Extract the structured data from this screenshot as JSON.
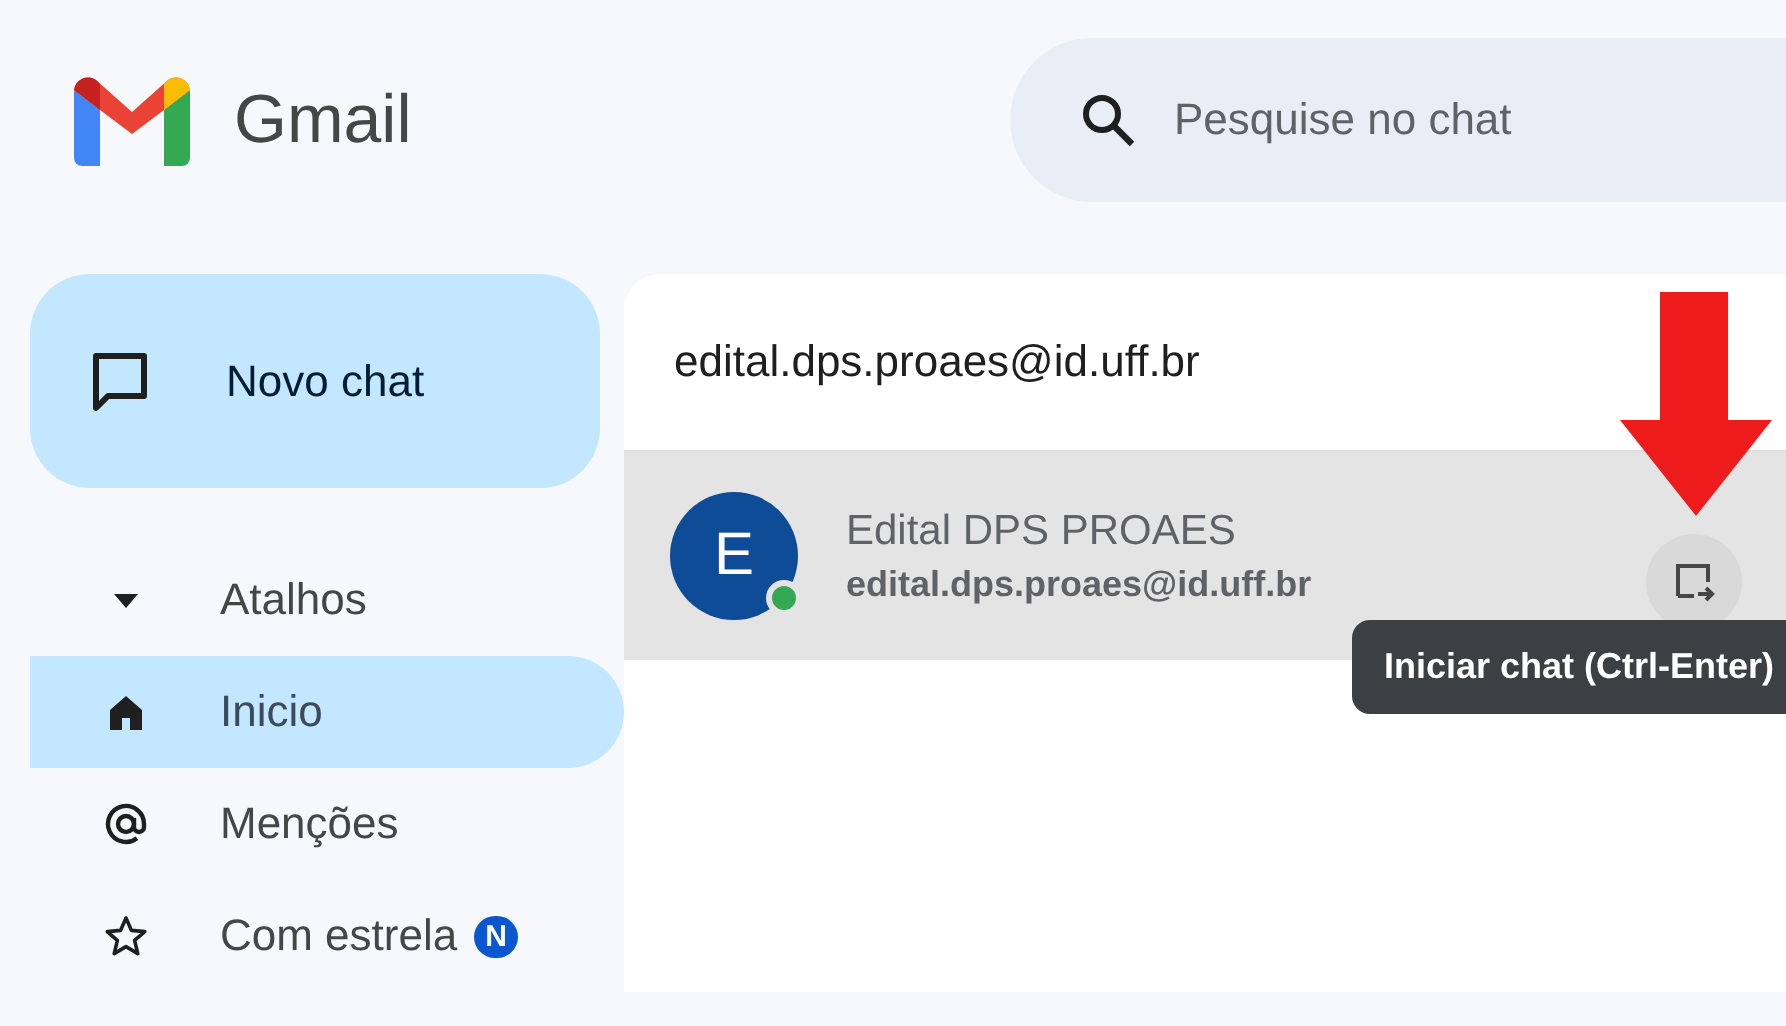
{
  "app": {
    "name": "Gmail"
  },
  "search": {
    "placeholder": "Pesquise no chat"
  },
  "new_chat_button": {
    "label": "Novo chat"
  },
  "nav": [
    {
      "kind": "section",
      "label": "Atalhos",
      "expanded": true,
      "selected": false
    },
    {
      "kind": "home",
      "label": "Inicio",
      "selected": true
    },
    {
      "kind": "mentions",
      "label": "Menções",
      "selected": false
    },
    {
      "kind": "starred",
      "label": "Com estrela",
      "selected": false,
      "badge": "N"
    }
  ],
  "chat_dialog": {
    "input": {
      "value": "edital.dps.proaes@id.uff.br"
    },
    "results": [
      {
        "initial": "E",
        "name": "Edital DPS PROAES",
        "email": "edital.dps.proaes@id.uff.br",
        "online": true,
        "selected": true
      }
    ],
    "start_chat_tooltip": "Iniciar chat (Ctrl-Enter)"
  }
}
